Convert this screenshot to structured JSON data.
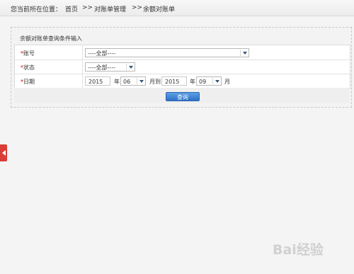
{
  "breadcrumb": {
    "label": "您当前所在位置：",
    "items": [
      "首页",
      "对账单管理",
      "余额对账单"
    ],
    "separator": ">>"
  },
  "panel": {
    "title": "余额对账单查询条件输入"
  },
  "form": {
    "account": {
      "label": "账号",
      "required": "*",
      "value": "----全部----"
    },
    "status": {
      "label": "状态",
      "required": "*",
      "value": "----全部----"
    },
    "date": {
      "label": "日期",
      "required": "*",
      "start_year": "2015",
      "start_month": "06",
      "end_year": "2015",
      "end_month": "09",
      "year_unit": "年",
      "month_to": "月到",
      "month_unit": "月"
    }
  },
  "actions": {
    "query_label": "查询"
  },
  "watermark": {
    "text": "Bai经验"
  },
  "colors": {
    "accent": "#2d70c8",
    "required": "#dd0000",
    "side_tab": "#d93d36"
  },
  "icons": {
    "side_tab": "chevron-left-icon"
  }
}
